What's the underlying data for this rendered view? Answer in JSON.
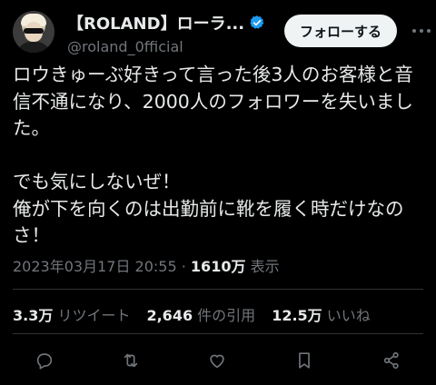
{
  "user": {
    "display_name": "【ROLAND】ローラ...",
    "handle": "@roland_0fficial",
    "follow_label": "フォローする"
  },
  "tweet": {
    "line1": "ロウきゅーぶ好きって言った後3人のお客様と音信不通になり、2000人のフォロワーを失いました。",
    "line2": "でも気にしないぜ！\n俺が下を向くのは出勤前に靴を履く時だけなのさ！"
  },
  "meta": {
    "datetime": "2023年03月17日 20:55",
    "separator": "·",
    "views_count": "1610万",
    "views_label": "表示"
  },
  "stats": {
    "retweets_count": "3.3万",
    "retweets_label": "リツイート",
    "quotes_count": "2,646",
    "quotes_label": "件の引用",
    "likes_count": "12.5万",
    "likes_label": "いいね"
  },
  "icons": [
    "verified-badge-icon",
    "more-icon",
    "reply-icon",
    "retweet-icon",
    "like-icon",
    "bookmark-icon",
    "share-icon"
  ],
  "colors": {
    "background": "#000000",
    "text": "#e7e9ea",
    "muted": "#71767b",
    "verified": "#1d9bf0"
  }
}
